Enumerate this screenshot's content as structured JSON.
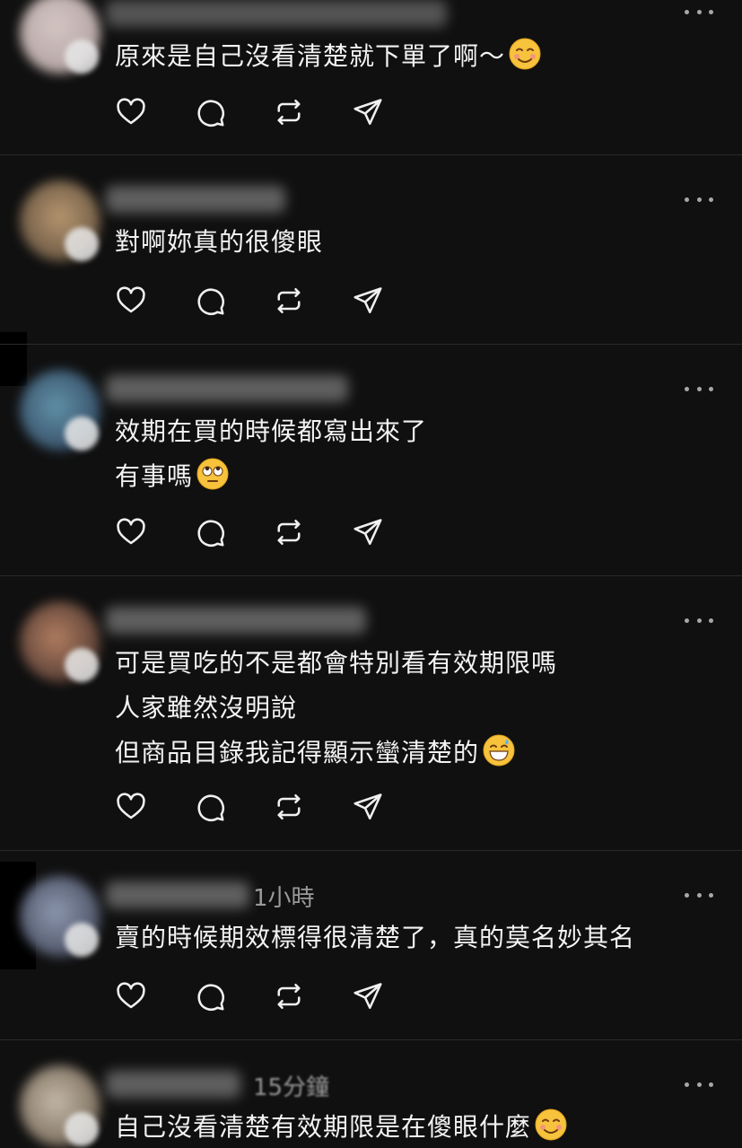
{
  "replies": [
    {
      "text": "原來是自己沒看清楚就下單了啊～",
      "emoji": "smiling-face-icon",
      "time": ""
    },
    {
      "text": "對啊妳真的很傻眼",
      "emoji": "",
      "time": ""
    },
    {
      "text": "效期在買的時候都寫出來了\n有事嗎",
      "emoji": "face-with-rolling-eyes-icon",
      "time": ""
    },
    {
      "text": "可是買吃的不是都會特別看有效期限嗎\n人家雖然沒明說\n但商品目錄我記得顯示蠻清楚的",
      "emoji": "grinning-face-with-sweat-icon",
      "time": ""
    },
    {
      "text": "賣的時候期效標得很清楚了，真的莫名妙其名",
      "emoji": "",
      "time": "1小時"
    },
    {
      "text": "自己沒看清楚有效期限是在傻眼什麼",
      "emoji": "smiling-face-icon",
      "time": "15分鐘"
    }
  ],
  "icons": {
    "like": "heart-icon",
    "comment": "comment-icon",
    "repost": "repost-icon",
    "share": "send-icon",
    "more": "more-dots-icon"
  },
  "colors": {
    "background": "#101010",
    "text": "#f3f3f3",
    "muted": "#9a9a9a",
    "divider": "#2a2a2a"
  }
}
